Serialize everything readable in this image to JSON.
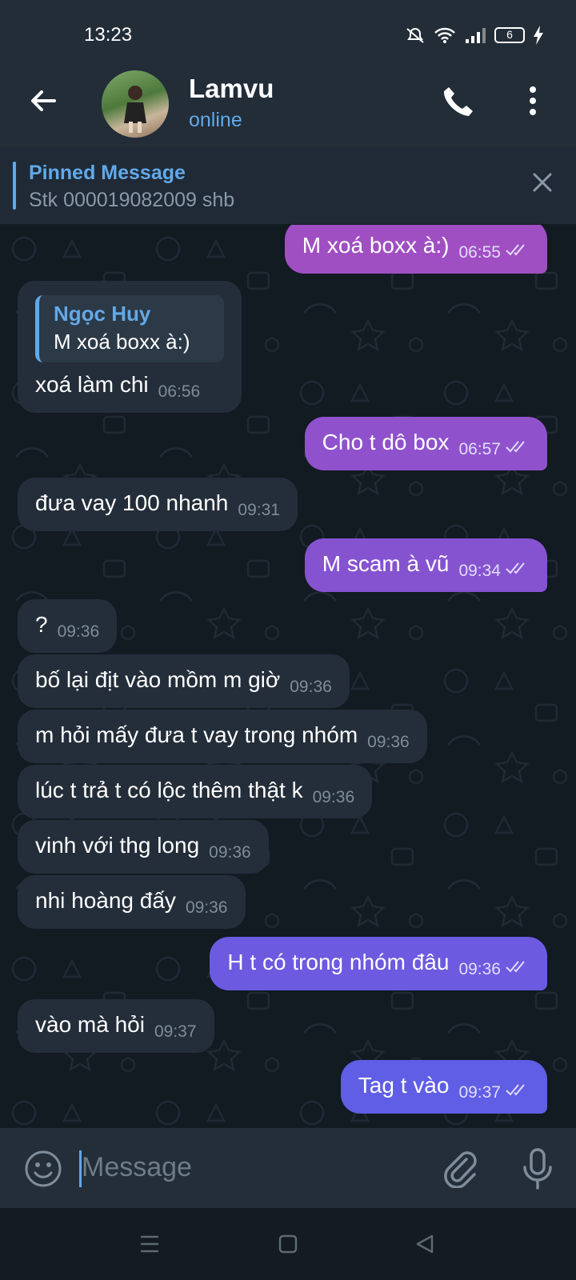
{
  "status_bar": {
    "time": "13:23",
    "battery": "6"
  },
  "header": {
    "name": "Lamvu",
    "status": "online"
  },
  "pinned": {
    "title": "Pinned Message",
    "text": "Stk 000019082009 shb"
  },
  "messages": [
    {
      "dir": "out",
      "text": "M xoá boxx à:)",
      "time": "06:55"
    },
    {
      "dir": "in",
      "reply_name": "Ngọc Huy",
      "reply_text": "M xoá boxx à:)",
      "text": "xoá làm chi",
      "time": "06:56"
    },
    {
      "dir": "out",
      "text": "Cho t dô box",
      "time": "06:57"
    },
    {
      "dir": "in",
      "text": "đưa vay 100 nhanh",
      "time": "09:31"
    },
    {
      "dir": "out",
      "text": "M scam à vũ",
      "time": "09:34"
    },
    {
      "dir": "in",
      "text": "?",
      "time": "09:36"
    },
    {
      "dir": "in",
      "text": "bố lại địt vào mồm m giờ",
      "time": "09:36"
    },
    {
      "dir": "in",
      "text": "m hỏi mấy đưa t vay trong nhóm",
      "time": "09:36"
    },
    {
      "dir": "in",
      "text": "lúc t trả t có lộc thêm thật k",
      "time": "09:36"
    },
    {
      "dir": "in",
      "text": "vinh với thg long",
      "time": "09:36"
    },
    {
      "dir": "in",
      "text": "nhi hoàng đấy",
      "time": "09:36"
    },
    {
      "dir": "out",
      "text": "H t có trong nhóm đâu",
      "time": "09:36"
    },
    {
      "dir": "in",
      "text": "vào mà hỏi",
      "time": "09:37"
    },
    {
      "dir": "out",
      "text": "Tag t vào",
      "time": "09:37"
    }
  ],
  "input": {
    "placeholder": "Message"
  },
  "colors": {
    "accent": "#62a9e8",
    "bubble_in": "#242e3a",
    "gradient_top": "#9b4fc0",
    "gradient_bottom": "#5b5ee3"
  }
}
